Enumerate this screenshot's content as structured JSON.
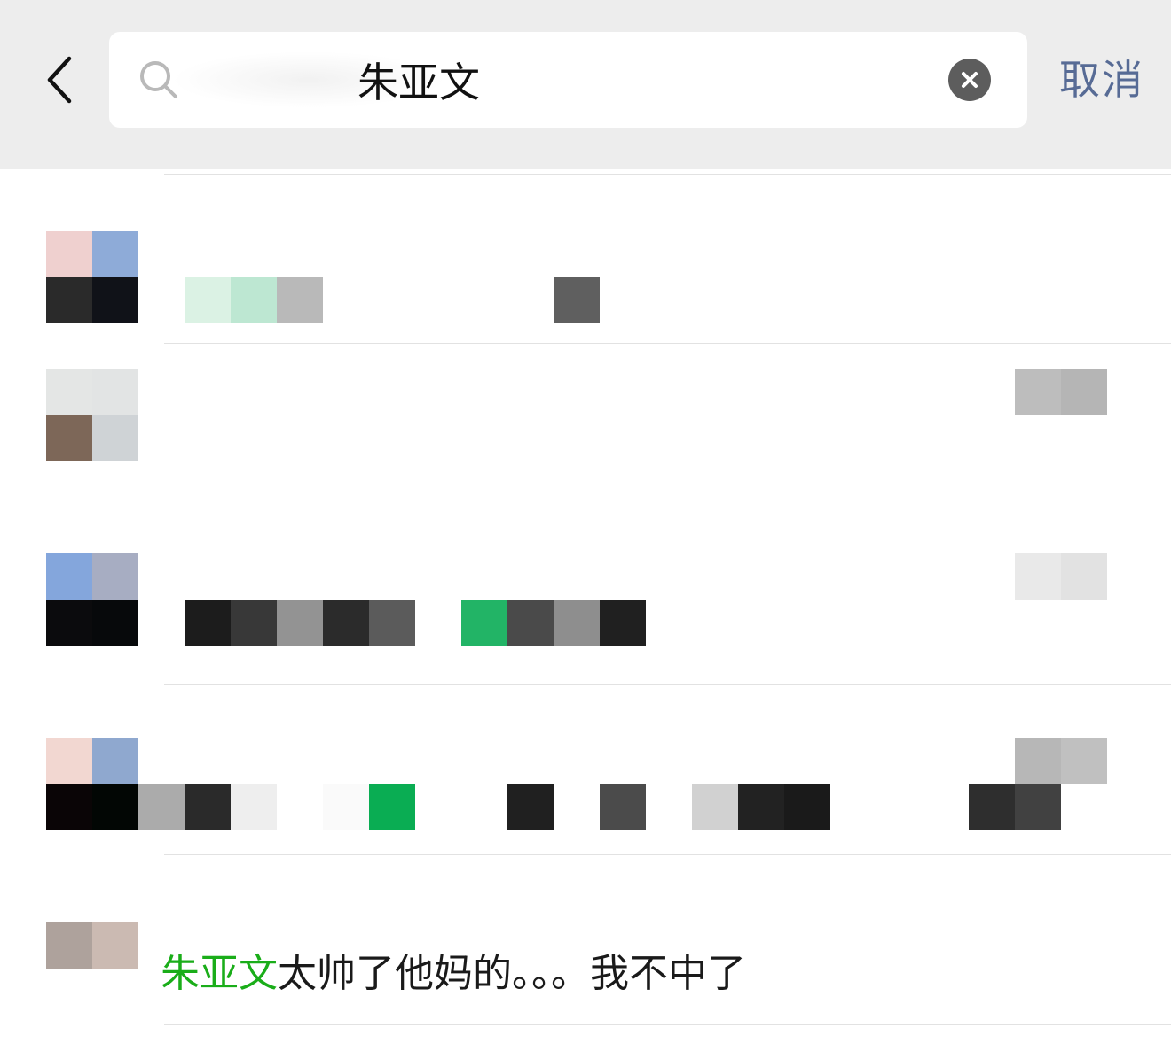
{
  "search": {
    "query": "朱亚文",
    "cancel_label": "取消",
    "icons": {
      "back": "chevron-left-icon",
      "search": "search-icon",
      "clear": "clear-circle-icon"
    }
  },
  "results": [
    {
      "id": 1,
      "content": "redacted"
    },
    {
      "id": 2,
      "content": "redacted"
    },
    {
      "id": 3,
      "content": "redacted"
    },
    {
      "id": 4,
      "content": "redacted"
    },
    {
      "id": 5,
      "match": "朱亚文",
      "rest": "太帅了他妈的。。。我不中了"
    }
  ],
  "colors": {
    "highlight": "#1aad19",
    "cancel": "#576b95",
    "topbar": "#ededed"
  }
}
